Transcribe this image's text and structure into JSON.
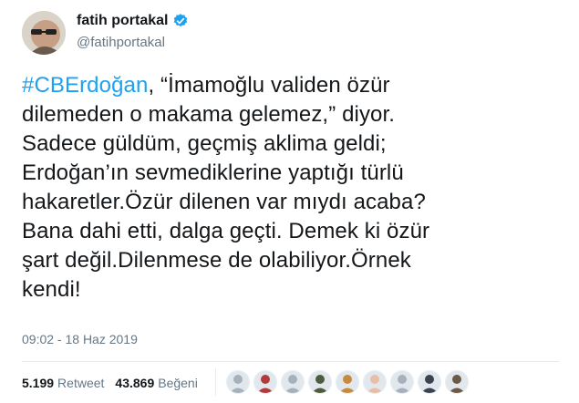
{
  "user": {
    "display_name": "fatih portakal",
    "handle": "@fatihportakal",
    "verified_icon": "verified-badge-icon",
    "avatar_icon": "profile-photo"
  },
  "tweet": {
    "hashtag": "#CBErdoğan",
    "lines": [
      ", “İmamoğlu validen özür",
      "dilemeden o makama gelemez,” diyor.",
      "Sadece güldüm, geçmiş aklima geldi;",
      "Erdoğan’ın sevmediklerine yaptığı türlü",
      "hakaretler.Özür dilenen var mıydı acaba?",
      "Bana dahi etti, dalga geçti. Demek ki özür",
      "şart değil.Dilenmese de olabiliyor.Örnek",
      "kendi!"
    ],
    "timestamp": "09:02 - 18 Haz 2019"
  },
  "stats": {
    "retweet_count": "5.199",
    "retweet_label": "Retweet",
    "like_count": "43.869",
    "like_label": "Beğeni"
  },
  "likers": [
    {
      "name": "liker-avatar-1",
      "color": "#a7b1bb"
    },
    {
      "name": "liker-avatar-2",
      "color": "#b33a3a"
    },
    {
      "name": "liker-avatar-3",
      "color": "#a7b1bb"
    },
    {
      "name": "liker-avatar-4",
      "color": "#4f5b3d"
    },
    {
      "name": "liker-avatar-5",
      "color": "#c8893f"
    },
    {
      "name": "liker-avatar-6",
      "color": "#e7bfa6"
    },
    {
      "name": "liker-avatar-7",
      "color": "#a7b1bb"
    },
    {
      "name": "liker-avatar-8",
      "color": "#3b4350"
    },
    {
      "name": "liker-avatar-9",
      "color": "#6b5a48"
    }
  ],
  "colors": {
    "accent": "#1da1f2",
    "text": "#14171a",
    "muted": "#657786",
    "divider": "#e6ecf0"
  }
}
